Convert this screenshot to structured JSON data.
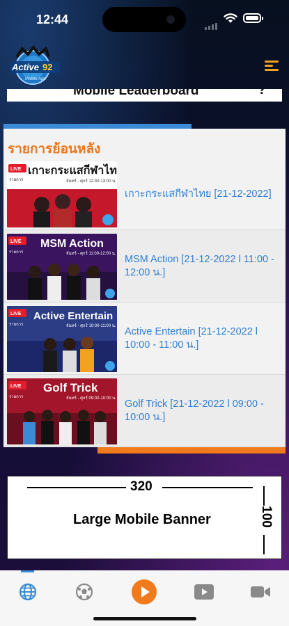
{
  "status_bar": {
    "time": "12:44"
  },
  "header": {
    "logo_text": "Active",
    "logo_number": "92",
    "logo_subtext": "Mobile App"
  },
  "leaderboard_ad": {
    "label": "Mobile Leaderboard"
  },
  "replay": {
    "title": "รายการย้อนหลัง",
    "items": [
      {
        "label": "เกาะกระแสกีฬาไทย [21-12-2022]",
        "thumb_title": "เกาะกระแสกีฬาไทย",
        "thumb_time": "จันทร์ - ศุกร์ 12:30-13:00 น."
      },
      {
        "label": "MSM Action [21-12-2022 l 11:00 - 12:00 น.]",
        "thumb_title": "MSM Action",
        "thumb_time": "จันทร์ - ศุกร์ 11:00-12:00 น."
      },
      {
        "label": "Active Entertain [21-12-2022 l 10:00 - 11:00 น.]",
        "thumb_title": "Active Entertain",
        "thumb_time": "จันทร์ - ศุกร์ 10:00-11:00 น."
      },
      {
        "label": "Golf Trick [21-12-2022 l 09:00 - 10:00 น.]",
        "thumb_title": "Golf Trick",
        "thumb_time": "จันทร์ - ศุกร์ 09:00-10:00 น."
      }
    ],
    "thumb_live": "LIVE",
    "thumb_sub": "รายการ"
  },
  "large_banner_ad": {
    "label": "Large Mobile Banner",
    "width_label": "320",
    "height_label": "100"
  },
  "tabs": [
    {
      "name": "web",
      "icon": "globe-icon"
    },
    {
      "name": "football",
      "icon": "soccer-ball-icon"
    },
    {
      "name": "play",
      "icon": "play-icon"
    },
    {
      "name": "video",
      "icon": "video-player-icon"
    },
    {
      "name": "camera",
      "icon": "video-camera-icon"
    }
  ],
  "colors": {
    "accent_blue": "#3a8ad6",
    "accent_orange": "#f07a1c",
    "title_orange": "#e8771f",
    "link_blue": "#2f7fd3"
  }
}
